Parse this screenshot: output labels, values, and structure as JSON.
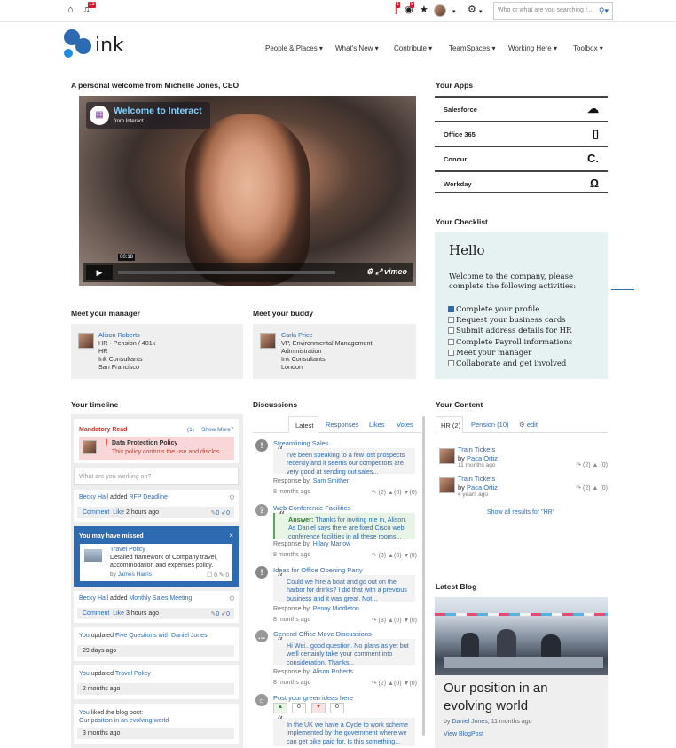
{
  "topbar": {
    "notif_badge": "13",
    "alert_badge": "1",
    "watch_badge": "5",
    "search_placeholder": "Who or what are you searching f..."
  },
  "brand": {
    "name": "ink",
    "color": "#2e6ab1"
  },
  "nav": [
    "People & Places",
    "What's New",
    "Contribute",
    "TeamSpaces",
    "Working Here",
    "Toolbox"
  ],
  "welcome": {
    "heading": "A personal welcome from Michelle Jones, CEO",
    "video_title": "Welcome to Interact",
    "video_sub": "from Interact",
    "video_time": "00:18",
    "video_brand": "vimeo"
  },
  "manager": {
    "heading": "Meet your manager",
    "name": "Alison Roberts",
    "lines": [
      "HR - Pension / 401k",
      "HR",
      "Ink Consultants",
      "San Francisco"
    ]
  },
  "buddy": {
    "heading": "Meet your buddy",
    "name": "Carla Price",
    "lines": [
      "VP, Environmental Management",
      "Administration",
      "Ink Consultants",
      "London"
    ]
  },
  "apps": {
    "heading": "Your Apps",
    "items": [
      {
        "label": "Salesforce",
        "icon": "cloud-icon"
      },
      {
        "label": "Office 365",
        "icon": "office-icon"
      },
      {
        "label": "Concur",
        "icon": "concur-icon"
      },
      {
        "label": "Workday",
        "icon": "workday-icon"
      }
    ]
  },
  "checklist": {
    "heading": "Your Checklist",
    "title": "Hello",
    "intro": "Welcome to the company, please complete the following activities:",
    "items": [
      {
        "label": "Complete your profile",
        "checked": true
      },
      {
        "label": "Request your business cards",
        "checked": false
      },
      {
        "label": "Submit address details for HR",
        "checked": false
      },
      {
        "label": "Complete Payroll informations",
        "checked": false
      },
      {
        "label": "Meet your manager",
        "checked": false
      },
      {
        "label": "Collaborate and get involved",
        "checked": false
      }
    ]
  },
  "timeline": {
    "heading": "Your timeline",
    "mandatory_label": "Mandatory Read",
    "mandatory_count": "(1)",
    "show_more": "Show More",
    "policy_title": "Data Protection Policy",
    "policy_desc": "This policy controls the use and disclos...",
    "status_placeholder": "What are you working on?",
    "items": [
      {
        "actor": "Becky Hall",
        "verb": "added",
        "target": "RFP Deadline",
        "comment": "Comment",
        "like": "Like",
        "time": "2 hours ago",
        "a": "0",
        "b": "0"
      },
      {
        "actor": "Becky Hall",
        "verb": "added",
        "target": "Monthly Sales Meeting",
        "comment": "Comment",
        "like": "Like",
        "time": "3 hours ago",
        "a": "0",
        "b": "0"
      }
    ],
    "missed": {
      "heading": "You may have missed",
      "title": "Travel Policy",
      "desc": "Detailed framework of Company travel, accommodation and expenses policy.",
      "by": "by",
      "author": "James Harris",
      "a": "0",
      "b": "0"
    },
    "updates": [
      {
        "you": "You",
        "verb": "updated",
        "target": "Five Questions with Daniel Jones",
        "time": "29 days ago"
      },
      {
        "you": "You",
        "verb": "updated",
        "target": "Travel Policy",
        "time": "2 months ago"
      },
      {
        "you": "You",
        "verb": "liked the blog post:",
        "target": "Our position in an evolving world",
        "time": "3 months ago"
      }
    ]
  },
  "discussions": {
    "heading": "Discussions",
    "tabs": [
      "Latest",
      "Responses",
      "Likes",
      "Votes"
    ],
    "items": [
      {
        "title": "Streamlining Sales",
        "quote": "I've been speaking to a few lost prospects recently and it seems our competitors are very good at sending out sales...",
        "resp_label": "Response by:",
        "resp_by": "Sam Smither",
        "time": "8 months ago",
        "replies": "(2)",
        "a": "(0)",
        "b": "(0)"
      },
      {
        "title": "Web Conference Facilities",
        "answer_label": "Answer:",
        "quote": "Thanks for inviting me in, Alison. As Daniel says there are fixed Cisco web conference facilities in all these rooms...",
        "resp_label": "Response by:",
        "resp_by": "Hilary Marlow",
        "time": "8 months ago",
        "replies": "(3)",
        "a": "(0)",
        "b": "(0)"
      },
      {
        "title": "Ideas for Office Opening Party",
        "quote": "Could we hire a boat and go out on the harbor for drinks? I did that with a previous business and it was great. Not...",
        "resp_label": "Response by:",
        "resp_by": "Penny Middleton",
        "time": "8 months ago",
        "replies": "(3)",
        "a": "(0)",
        "b": "(0)"
      },
      {
        "title": "General Office Move Discussions",
        "quote": "Hi Wei.. good question. No plans as yet but we'll certainly take your comment into consideration. Thanks...",
        "resp_label": "Response by:",
        "resp_by": "Alison Roberts",
        "time": "8 months ago",
        "replies": "(2)",
        "a": "(0)",
        "b": "(0)"
      }
    ],
    "idea": {
      "title": "Post your green ideas here",
      "up": "0",
      "down": "0",
      "quote": "In the UK we have a Cycle to work scheme implemented by the government where we can get bike paid for. Is this something..."
    }
  },
  "content": {
    "heading": "Your Content",
    "tabs": [
      "HR (2)",
      "Pension (10)",
      "edit"
    ],
    "items": [
      {
        "title": "Train Tickets",
        "by": "by",
        "author": "Paca Ortiz",
        "time": "11 months ago",
        "a": "(2)",
        "b": "(0)"
      },
      {
        "title": "Train Tickets",
        "by": "by",
        "author": "Paca Ortiz",
        "time": "4 years ago",
        "a": "(2)",
        "b": "(0)"
      }
    ],
    "show_all": "Show all results for \"HR\""
  },
  "blog": {
    "heading": "Latest Blog",
    "title": "Our position in an evolving world",
    "by": "by",
    "author": "Daniel Jones",
    "time": ", 11 months ago",
    "view": "View BlogPost"
  }
}
